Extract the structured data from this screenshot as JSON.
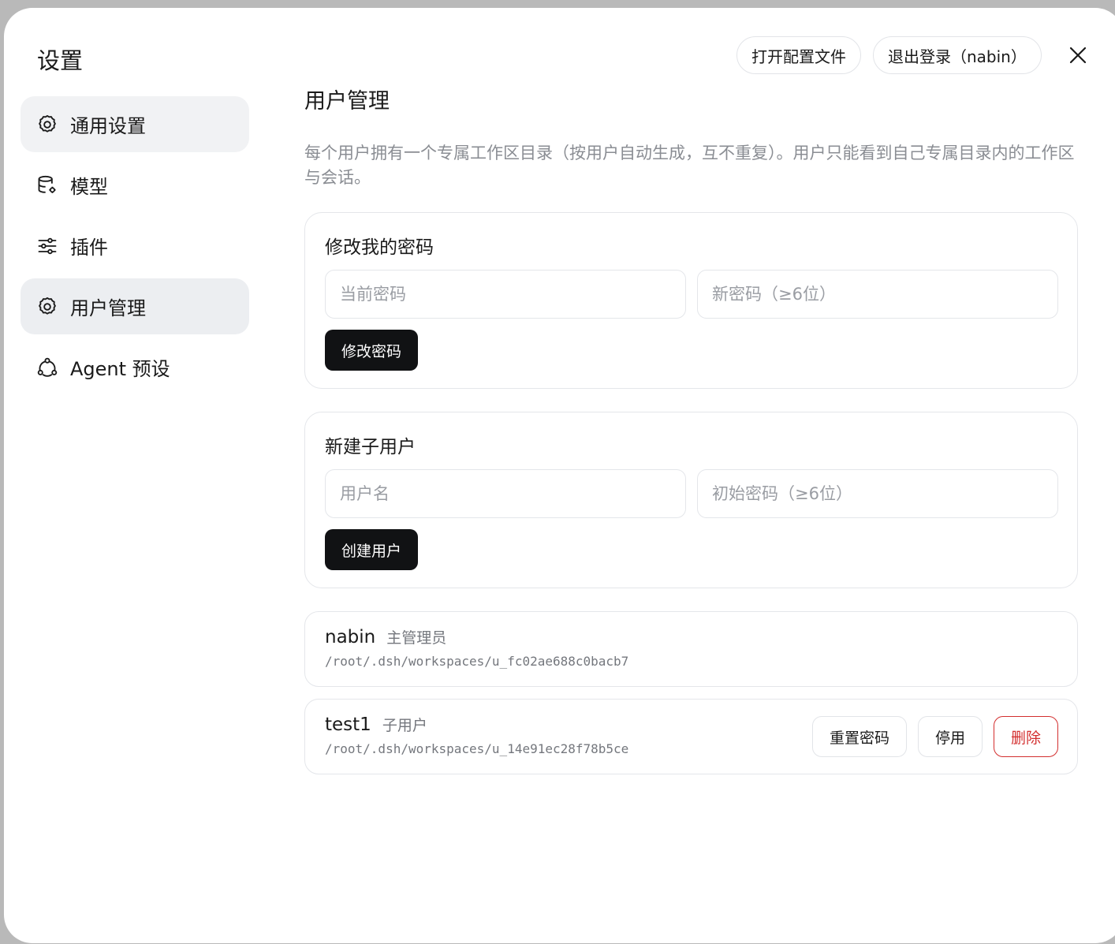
{
  "dialog": {
    "title": "设置",
    "open_config_label": "打开配置文件",
    "logout_label": "退出登录（nabin）"
  },
  "sidebar": {
    "items": [
      {
        "label": "通用设置",
        "icon": "gear-icon"
      },
      {
        "label": "模型",
        "icon": "database-settings-icon"
      },
      {
        "label": "插件",
        "icon": "sliders-icon"
      },
      {
        "label": "用户管理",
        "icon": "gear-icon"
      },
      {
        "label": "Agent 预设",
        "icon": "share-nodes-icon"
      }
    ]
  },
  "main": {
    "title": "用户管理",
    "description": "每个用户拥有一个专属工作区目录（按用户自动生成，互不重复）。用户只能看到自己专属目录内的工作区与会话。",
    "change_password": {
      "title": "修改我的密码",
      "current_placeholder": "当前密码",
      "new_placeholder": "新密码（≥6位）",
      "button": "修改密码"
    },
    "create_user": {
      "title": "新建子用户",
      "username_placeholder": "用户名",
      "password_placeholder": "初始密码（≥6位）",
      "button": "创建用户"
    },
    "users": [
      {
        "name": "nabin",
        "role": "主管理员",
        "path": "/root/.dsh/workspaces/u_fc02ae688c0bacb7"
      },
      {
        "name": "test1",
        "role": "子用户",
        "path": "/root/.dsh/workspaces/u_14e91ec28f78b5ce",
        "actions": {
          "reset": "重置密码",
          "disable": "停用",
          "delete": "删除"
        }
      }
    ]
  },
  "colors": {
    "danger": "#d32f2f",
    "primary_button": "#111214",
    "active_nav": "#eceef1"
  }
}
